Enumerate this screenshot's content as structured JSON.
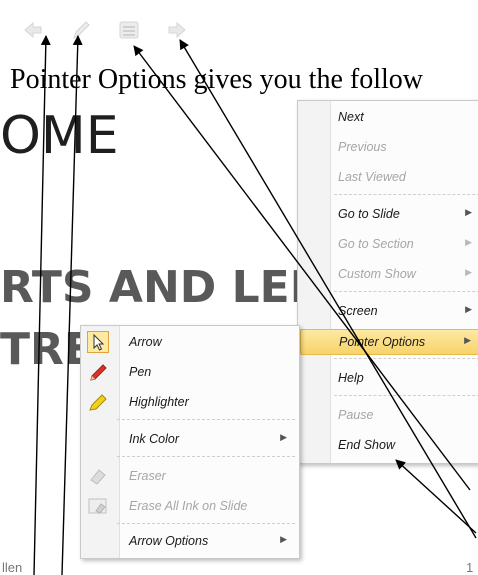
{
  "caption": "Pointer Options gives you the follow",
  "slide": {
    "title_partial": "OME",
    "line1_partial": "RTS AND LEISU",
    "line2_partial": "TRE",
    "footer_partial": "llen",
    "page_number": "1"
  },
  "toolbar": {
    "icons": [
      "back-arrow-icon",
      "pen-icon",
      "menu-icon",
      "forward-arrow-icon"
    ]
  },
  "context_menu": {
    "items": [
      {
        "label": "Next",
        "state": "enabled"
      },
      {
        "label": "Previous",
        "state": "disabled"
      },
      {
        "label": "Last Viewed",
        "state": "disabled"
      },
      {
        "label": "Go to Slide",
        "state": "enabled",
        "submenu": true
      },
      {
        "label": "Go to Section",
        "state": "disabled",
        "submenu": true
      },
      {
        "label": "Custom Show",
        "state": "disabled",
        "submenu": true
      },
      {
        "label": "Screen",
        "state": "enabled",
        "submenu": true
      },
      {
        "label": "Pointer Options",
        "state": "highlighted",
        "submenu": true
      },
      {
        "label": "Help",
        "state": "enabled"
      },
      {
        "label": "Pause",
        "state": "disabled"
      },
      {
        "label": "End Show",
        "state": "enabled"
      }
    ]
  },
  "pointer_submenu": {
    "items": [
      {
        "label": "Arrow",
        "icon": "cursor-arrow-icon",
        "selected": true
      },
      {
        "label": "Pen",
        "icon": "red-pen-icon"
      },
      {
        "label": "Highlighter",
        "icon": "yellow-highlighter-icon"
      },
      {
        "label": "Ink Color",
        "submenu": true
      },
      {
        "label": "Eraser",
        "icon": "eraser-icon",
        "state": "disabled"
      },
      {
        "label": "Erase All Ink on Slide",
        "icon": "erase-all-icon",
        "state": "disabled"
      },
      {
        "label": "Arrow Options",
        "submenu": true
      }
    ]
  },
  "colors": {
    "highlight_top": "#fde9a2",
    "highlight_bottom": "#f8d36a",
    "disabled_text": "#a6a6a6",
    "pen_red": "#d9342b",
    "highlighter_yellow": "#e6c619"
  }
}
